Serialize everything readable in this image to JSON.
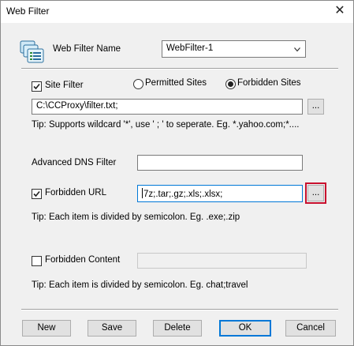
{
  "window": {
    "title": "Web Filter",
    "close_glyph": "✕"
  },
  "name_row": {
    "label": "Web Filter Name",
    "value": "WebFilter-1"
  },
  "site_filter": {
    "checkbox_label": "Site Filter",
    "checked": true,
    "radio_permitted": "Permitted Sites",
    "radio_forbidden": "Forbidden Sites",
    "selected": "forbidden",
    "path_value": "C:\\CCProxy\\filter.txt;",
    "browse_label": "...",
    "tip": "Tip: Supports wildcard '*', use ' ; ' to seperate. Eg. *.yahoo.com;*...."
  },
  "dns": {
    "label": "Advanced DNS Filter",
    "value": ""
  },
  "forbidden_url": {
    "checkbox_label": "Forbidden URL",
    "checked": true,
    "value": "7z;.tar;.gz;.xls;.xlsx;",
    "browse_label": "...",
    "tip": "Tip: Each item is divided by semicolon. Eg. .exe;.zip"
  },
  "forbidden_content": {
    "checkbox_label": "Forbidden Content",
    "checked": false,
    "value": "",
    "tip": "Tip: Each item is divided by semicolon. Eg. chat;travel"
  },
  "buttons": {
    "new": "New",
    "save": "Save",
    "delete": "Delete",
    "ok": "OK",
    "cancel": "Cancel"
  },
  "colors": {
    "highlight": "#c8102e",
    "ok_border": "#0078d7"
  }
}
